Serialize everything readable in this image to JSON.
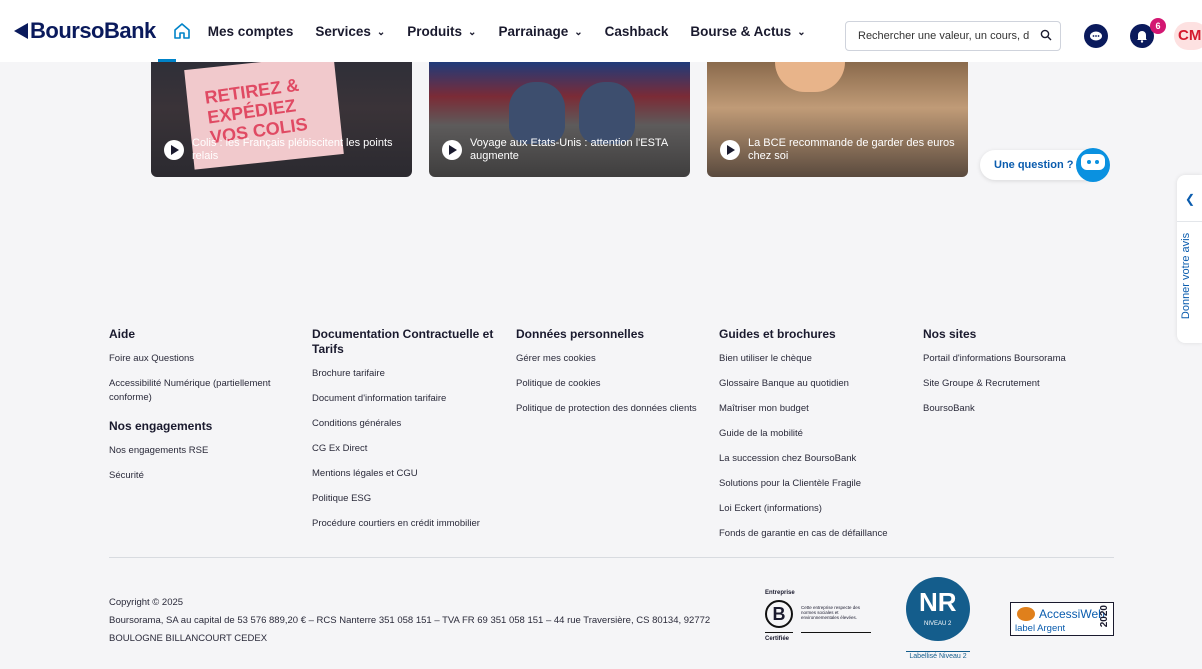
{
  "header": {
    "logo": {
      "part1": "Bourso",
      "part2": "Bank"
    },
    "nav": [
      {
        "label": "Mes comptes",
        "dropdown": false
      },
      {
        "label": "Services",
        "dropdown": true
      },
      {
        "label": "Produits",
        "dropdown": true
      },
      {
        "label": "Parrainage",
        "dropdown": true
      },
      {
        "label": "Cashback",
        "dropdown": false
      },
      {
        "label": "Bourse & Actus",
        "dropdown": true
      }
    ],
    "search_placeholder": "Rechercher une valeur, un cours, d",
    "notifications_count": "6",
    "avatar_initials": "CM"
  },
  "cards": [
    {
      "caption": "Colis : les Français plébiscitent les points relais",
      "image_text": "RETIREZ & EXPÉDIEZ VOS COLIS"
    },
    {
      "caption": "Voyage aux Etats-Unis : attention l'ESTA augmente"
    },
    {
      "caption": "La BCE recommande de garder des euros chez soi"
    }
  ],
  "chatbot": {
    "label": "Une question ?"
  },
  "side_tab": {
    "label": "Donner votre avis"
  },
  "footer": {
    "cols": [
      {
        "title": "Aide",
        "links": [
          "Foire aux Questions",
          "Accessibilité Numérique (partiellement conforme)"
        ],
        "sub_title": "Nos engagements",
        "sub_links": [
          "Nos engagements RSE",
          "Sécurité"
        ]
      },
      {
        "title": "Documentation Contractuelle et Tarifs",
        "links": [
          "Brochure tarifaire",
          "Document d'information tarifaire",
          "Conditions générales",
          "CG Ex Direct",
          "Mentions légales et CGU",
          "Politique ESG",
          "Procédure courtiers en crédit immobilier"
        ]
      },
      {
        "title": "Données personnelles",
        "links": [
          "Gérer mes cookies",
          "Politique de cookies",
          "Politique de protection des données clients"
        ]
      },
      {
        "title": "Guides et brochures",
        "links": [
          "Bien utiliser le chèque",
          "Glossaire Banque au quotidien",
          "Maîtriser mon budget",
          "Guide de la mobilité",
          "La succession chez BoursoBank",
          "Solutions pour la Clientèle Fragile",
          "Loi Eckert (informations)",
          "Fonds de garantie en cas de défaillance"
        ]
      },
      {
        "title": "Nos sites",
        "links": [
          "Portail d'informations Boursorama",
          "Site Groupe & Recrutement",
          "BoursoBank"
        ]
      }
    ],
    "copyright": "Copyright © 2025",
    "legal": "Boursorama, SA au capital de 53 576 889,20 € – RCS Nanterre 351 058 151 – TVA FR 69 351 058 151 – 44 rue Traversière, CS 80134, 92772 BOULOGNE BILLANCOURT CEDEX",
    "badges": {
      "bcorp_top": "Entreprise",
      "bcorp_bottom": "Certifiée",
      "bcorp_letter": "B",
      "bcorp_desc": "Cette entreprise respecte des normes sociales et environnementales élevées.",
      "nr_title": "NR",
      "nr_level": "NIVEAU 2",
      "nr_label": "Labellisé Niveau 2",
      "aw_title": "AccessiWeb",
      "aw_sub": "label Argent",
      "aw_year": "2020"
    }
  }
}
